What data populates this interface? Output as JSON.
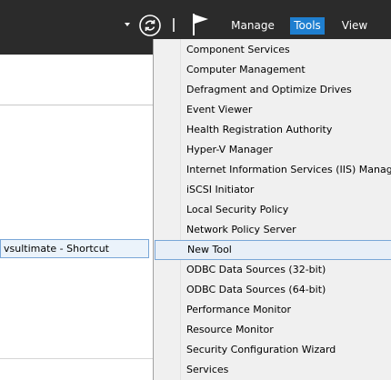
{
  "header": {
    "menus": [
      {
        "label": "Manage"
      },
      {
        "label": "Tools"
      },
      {
        "label": "View"
      }
    ],
    "refresh_icon": "refresh-icon",
    "flag_icon": "notification-flag-icon",
    "accent_color": "#1f7fd0"
  },
  "left_panel": {
    "selected_item": "vsultimate - Shortcut"
  },
  "tools_menu": {
    "items": [
      {
        "label": "Component Services"
      },
      {
        "label": "Computer Management"
      },
      {
        "label": "Defragment and Optimize Drives"
      },
      {
        "label": "Event Viewer"
      },
      {
        "label": "Health Registration Authority"
      },
      {
        "label": "Hyper-V Manager"
      },
      {
        "label": "Internet Information Services (IIS) Manager"
      },
      {
        "label": "iSCSI Initiator"
      },
      {
        "label": "Local Security Policy"
      },
      {
        "label": "Network Policy Server"
      },
      {
        "label": "New Tool"
      },
      {
        "label": "ODBC Data Sources (32-bit)"
      },
      {
        "label": "ODBC Data Sources (64-bit)"
      },
      {
        "label": "Performance Monitor"
      },
      {
        "label": "Resource Monitor"
      },
      {
        "label": "Security Configuration Wizard"
      },
      {
        "label": "Services"
      }
    ],
    "highlighted": "New Tool"
  }
}
